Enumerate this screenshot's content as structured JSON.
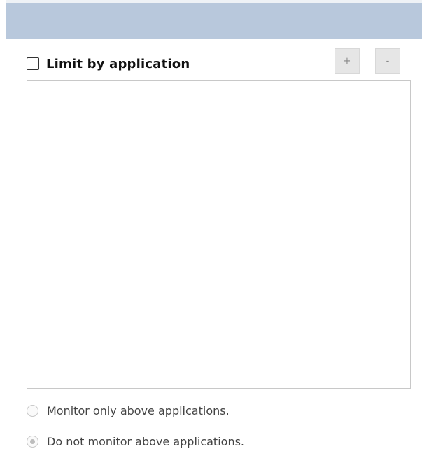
{
  "limit_by_application": {
    "label": "Limit by application",
    "checked": false
  },
  "list_buttons": {
    "add_label": "+",
    "remove_label": "-"
  },
  "application_list": {
    "items": []
  },
  "monitor_mode": {
    "options": [
      {
        "label": "Monitor only above applications.",
        "selected": false,
        "disabled": true
      },
      {
        "label": "Do not monitor above applications.",
        "selected": true,
        "disabled": true
      }
    ]
  }
}
